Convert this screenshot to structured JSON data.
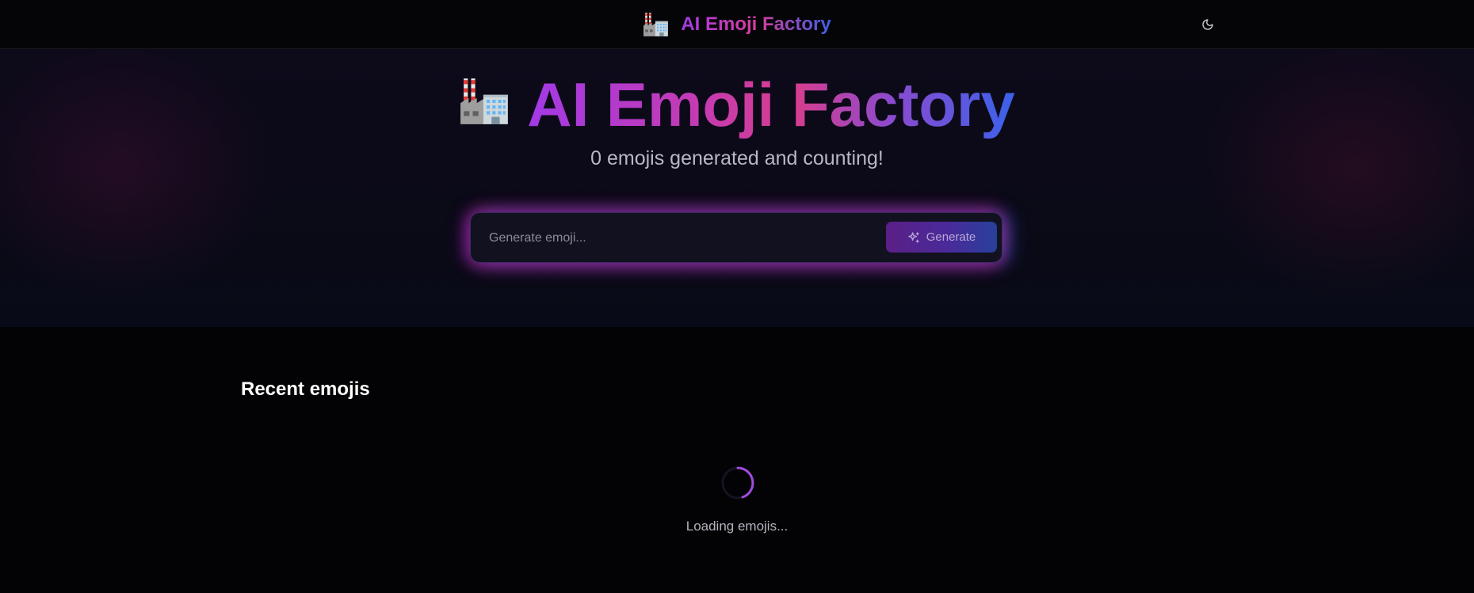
{
  "navbar": {
    "title": "AI Emoji Factory",
    "logo_icon": "factory-emoji-icon",
    "theme_toggle_icon": "moon-icon"
  },
  "hero": {
    "title": "AI Emoji Factory",
    "logo_icon": "factory-emoji-icon",
    "subtitle": "0 emojis generated and counting!"
  },
  "search": {
    "placeholder": "Generate emoji...",
    "value": "",
    "button_label": "Generate",
    "button_icon": "sparkles-icon"
  },
  "recent": {
    "title": "Recent emojis",
    "loading_text": "Loading emojis...",
    "spinner_icon": "loading-spinner-icon"
  },
  "colors": {
    "background": "#030306",
    "gradient_purple": "#a23ae6",
    "gradient_pink": "#d63d8e",
    "gradient_blue": "#3a62ea"
  }
}
